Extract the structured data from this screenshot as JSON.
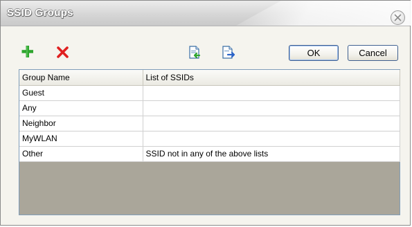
{
  "window": {
    "title": "SSID Groups"
  },
  "toolbar": {
    "ok_label": "OK",
    "cancel_label": "Cancel"
  },
  "table": {
    "columns": [
      "Group Name",
      "List of SSIDs"
    ],
    "rows": [
      {
        "group": "Guest",
        "ssids": ""
      },
      {
        "group": "Any",
        "ssids": ""
      },
      {
        "group": "Neighbor",
        "ssids": ""
      },
      {
        "group": "MyWLAN",
        "ssids": ""
      },
      {
        "group": "Other",
        "ssids": "SSID not in any of the above lists"
      }
    ]
  },
  "icons": {
    "add": "plus-icon",
    "delete": "x-icon",
    "import": "import-icon",
    "export": "export-icon",
    "close": "close-icon"
  },
  "colors": {
    "add_green": "#2ea52e",
    "delete_red": "#e02020",
    "table_empty_area": "#aaa69a",
    "button_border": "#3f5f8f"
  }
}
